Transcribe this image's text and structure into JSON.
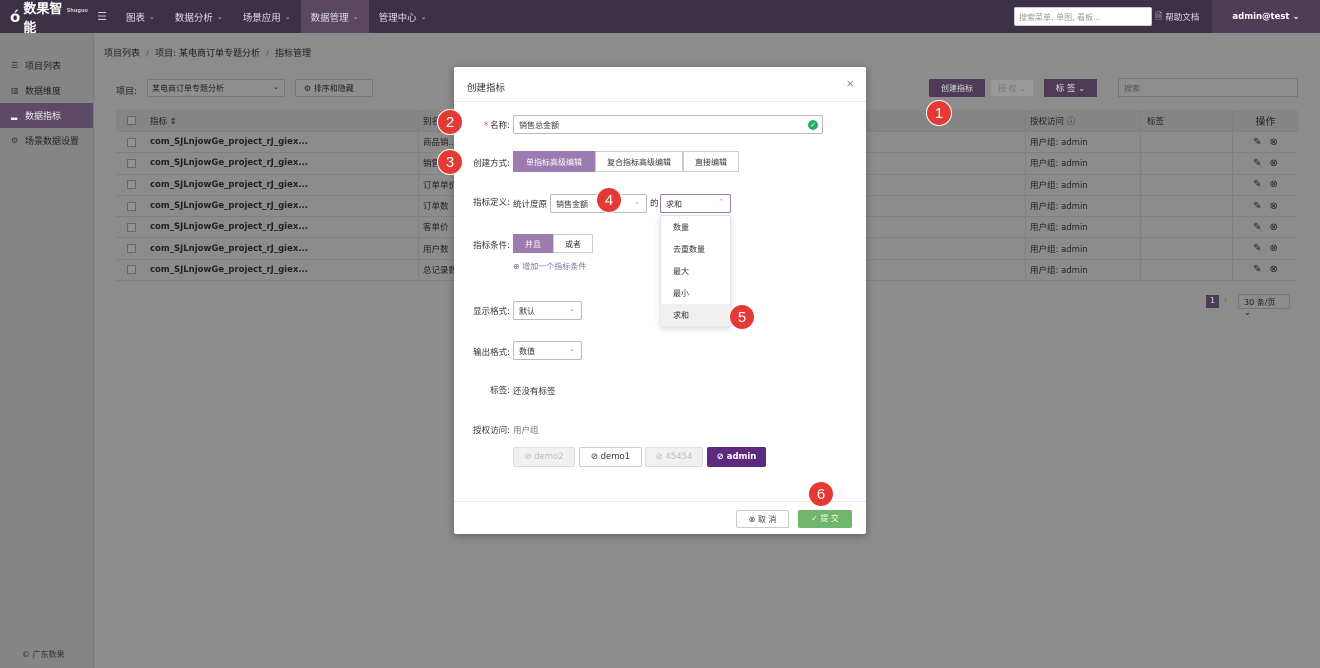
{
  "brand": {
    "name": "数果智能",
    "tag": "Shuguo"
  },
  "nav": {
    "items": [
      {
        "label": "图表",
        "chev": "⌄"
      },
      {
        "label": "数据分析",
        "chev": "⌄"
      },
      {
        "label": "场景应用",
        "chev": "⌄"
      },
      {
        "label": "数据管理",
        "chev": "⌄"
      },
      {
        "label": "管理中心",
        "chev": "⌄"
      }
    ],
    "search_placeholder": "搜索菜单, 单图, 看板...",
    "help_label": "帮助文档",
    "user_label": "admin@test ⌄"
  },
  "sidebar": {
    "items": [
      {
        "label": "项目列表",
        "icon": "list-icon"
      },
      {
        "label": "数据维度",
        "icon": "dimension-icon"
      },
      {
        "label": "数据指标",
        "icon": "chart-icon"
      },
      {
        "label": "场景数据设置",
        "icon": "settings-icon"
      }
    ],
    "footer": "© 广东数果"
  },
  "breadcrumb": {
    "items": [
      "项目列表",
      "项目: 某电商订单专题分析",
      "指标管理"
    ]
  },
  "toolbar": {
    "project_label": "项目:",
    "project_value": "某电商订单专题分析",
    "sort_label": "排序和隐藏",
    "create_label": "创建指标",
    "grey_label": "授 权 ⌄",
    "tag_label": "标 签 ⌄",
    "search_placeholder": "搜索"
  },
  "table": {
    "headers": [
      "指标 ⇕",
      "别名",
      "授权访问 ⓘ",
      "标签",
      "操作"
    ],
    "rows": [
      {
        "name": "com_SJLnjowGe_project_rJ_giex...",
        "alias": "商品销...",
        "access": "用户组: admin"
      },
      {
        "name": "com_SJLnjowGe_project_rJ_giex...",
        "alias": "销售...",
        "access": "用户组: admin"
      },
      {
        "name": "com_SJLnjowGe_project_rJ_giex...",
        "alias": "订单单价",
        "access": "用户组: admin"
      },
      {
        "name": "com_SJLnjowGe_project_rJ_giex...",
        "alias": "订单数",
        "access": "用户组: admin"
      },
      {
        "name": "com_SJLnjowGe_project_rJ_giex...",
        "alias": "客单价",
        "access": "用户组: admin"
      },
      {
        "name": "com_SJLnjowGe_project_rJ_giex...",
        "alias": "用户数",
        "access": "用户组: admin"
      },
      {
        "name": "com_SJLnjowGe_project_rJ_giex...",
        "alias": "总记录数",
        "access": "用户组: admin"
      }
    ]
  },
  "pager": {
    "page": "1",
    "next": "›",
    "size": "30 条/页 ⌄"
  },
  "modal": {
    "title": "创建指标",
    "close": "×",
    "name_label": "名称:",
    "name_value": "销售总金额",
    "mode_label": "创建方式:",
    "modes": [
      "单指标高级编辑",
      "复合指标高级编辑",
      "直接编辑"
    ],
    "def_label": "指标定义:",
    "def_prefix": "统计度原",
    "def_field": "销售金额",
    "def_of": "的",
    "def_agg": "求和",
    "agg_options": [
      "数量",
      "去重数量",
      "最大",
      "最小",
      "求和"
    ],
    "cond_label": "指标条件:",
    "cond_and": "并且",
    "cond_or": "或者",
    "add_cond": "增加一个指标条件",
    "display_label": "显示格式:",
    "display_value": "默认",
    "output_label": "输出格式:",
    "output_value": "数值",
    "tag_label": "标签:",
    "tag_value": "还没有标签",
    "access_label": "授权访问:",
    "access_sub": "用户组",
    "access_groups": [
      "demo2",
      "demo1",
      "45454",
      "admin"
    ],
    "cancel": "取 消",
    "submit": "提 交"
  },
  "badges": [
    "1",
    "2",
    "3",
    "4",
    "5",
    "6"
  ]
}
